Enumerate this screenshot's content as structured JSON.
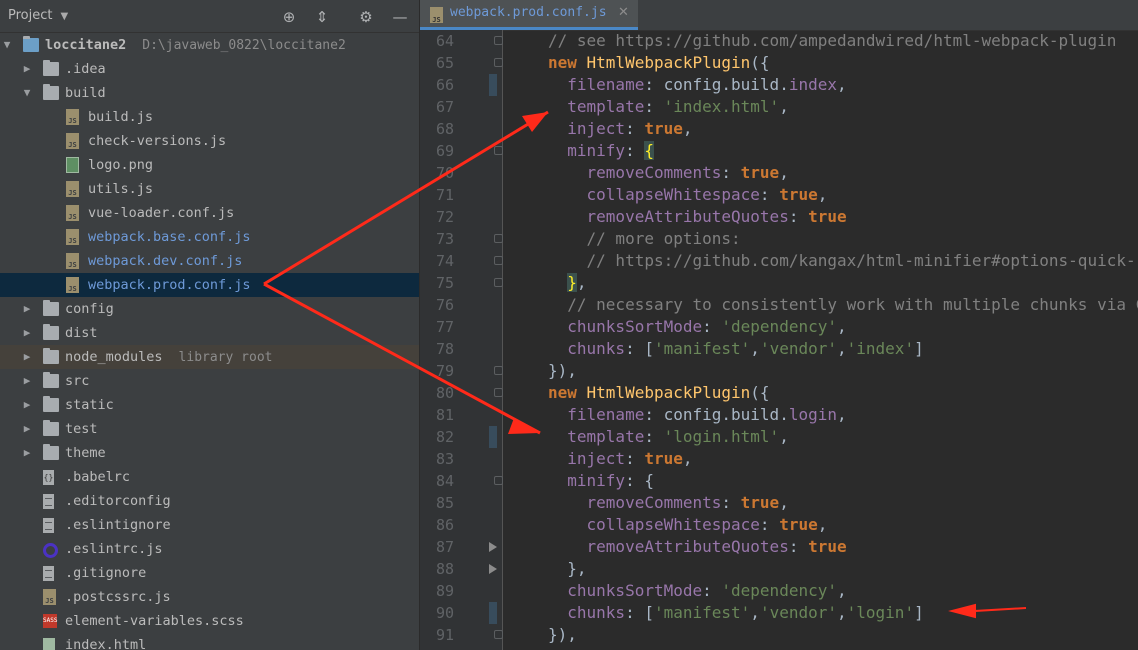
{
  "project_panel": {
    "title": "Project",
    "tree": [
      {
        "label": "loccitane2",
        "hint": "D:\\javaweb_0822\\loccitane2",
        "kind": "project",
        "depth": 0,
        "arrow": "down"
      },
      {
        "label": ".idea",
        "kind": "folder",
        "depth": 1,
        "arrow": "right"
      },
      {
        "label": "build",
        "kind": "folder",
        "depth": 1,
        "arrow": "down"
      },
      {
        "label": "build.js",
        "kind": "js",
        "depth": 2
      },
      {
        "label": "check-versions.js",
        "kind": "js",
        "depth": 2
      },
      {
        "label": "logo.png",
        "kind": "png",
        "depth": 2
      },
      {
        "label": "utils.js",
        "kind": "js",
        "depth": 2
      },
      {
        "label": "vue-loader.conf.js",
        "kind": "js",
        "depth": 2
      },
      {
        "label": "webpack.base.conf.js",
        "kind": "js",
        "depth": 2,
        "modified": true
      },
      {
        "label": "webpack.dev.conf.js",
        "kind": "js",
        "depth": 2,
        "modified": true
      },
      {
        "label": "webpack.prod.conf.js",
        "kind": "js",
        "depth": 2,
        "modified": true,
        "selected": true
      },
      {
        "label": "config",
        "kind": "folder",
        "depth": 1,
        "arrow": "right"
      },
      {
        "label": "dist",
        "kind": "folder",
        "depth": 1,
        "arrow": "right"
      },
      {
        "label": "node_modules",
        "hint": "library root",
        "kind": "folder",
        "depth": 1,
        "arrow": "right",
        "libroot": true
      },
      {
        "label": "src",
        "kind": "folder",
        "depth": 1,
        "arrow": "right"
      },
      {
        "label": "static",
        "kind": "folder",
        "depth": 1,
        "arrow": "right"
      },
      {
        "label": "test",
        "kind": "folder",
        "depth": 1,
        "arrow": "right"
      },
      {
        "label": "theme",
        "kind": "folder",
        "depth": 1,
        "arrow": "right"
      },
      {
        "label": ".babelrc",
        "kind": "babel",
        "depth": 1
      },
      {
        "label": ".editorconfig",
        "kind": "txt",
        "depth": 1
      },
      {
        "label": ".eslintignore",
        "kind": "txt",
        "depth": 1
      },
      {
        "label": ".eslintrc.js",
        "kind": "eslint",
        "depth": 1
      },
      {
        "label": ".gitignore",
        "kind": "txt",
        "depth": 1
      },
      {
        "label": ".postcssrc.js",
        "kind": "js",
        "depth": 1
      },
      {
        "label": "element-variables.scss",
        "kind": "sass",
        "depth": 1
      },
      {
        "label": "index.html",
        "kind": "html",
        "depth": 1
      }
    ]
  },
  "editor": {
    "tab_label": "webpack.prod.conf.js",
    "lines": [
      {
        "n": "64",
        "gutter": "fold",
        "tokens": [
          [
            "cm",
            "// see https://github.com/ampedandwired/html-webpack-plugin"
          ]
        ]
      },
      {
        "n": "65",
        "gutter": "fold",
        "tokens": [
          [
            "kw",
            "new "
          ],
          [
            "fn",
            "HtmlWebpackPlugin"
          ],
          [
            "pl",
            "({"
          ]
        ]
      },
      {
        "n": "66",
        "gutter": "chg",
        "tokens": [
          [
            "pl",
            "  "
          ],
          [
            "pr",
            "filename"
          ],
          [
            "pl",
            ": config.build."
          ],
          [
            "pr",
            "index"
          ],
          [
            "pl",
            ","
          ]
        ]
      },
      {
        "n": "67",
        "gutter": "",
        "tokens": [
          [
            "pl",
            "  "
          ],
          [
            "pr",
            "template"
          ],
          [
            "pl",
            ": "
          ],
          [
            "st",
            "'index.html'"
          ],
          [
            "pl",
            ","
          ]
        ]
      },
      {
        "n": "68",
        "gutter": "",
        "tokens": [
          [
            "pl",
            "  "
          ],
          [
            "pr",
            "inject"
          ],
          [
            "pl",
            ": "
          ],
          [
            "kw",
            "true"
          ],
          [
            "pl",
            ","
          ]
        ]
      },
      {
        "n": "69",
        "gutter": "fold",
        "tokens": [
          [
            "pl",
            "  "
          ],
          [
            "pr",
            "minify"
          ],
          [
            "pl",
            ": "
          ],
          [
            "brk",
            "{"
          ]
        ]
      },
      {
        "n": "70",
        "gutter": "",
        "tokens": [
          [
            "pl",
            "    "
          ],
          [
            "pr",
            "removeComments"
          ],
          [
            "pl",
            ": "
          ],
          [
            "kw",
            "true"
          ],
          [
            "pl",
            ","
          ]
        ]
      },
      {
        "n": "71",
        "gutter": "",
        "tokens": [
          [
            "pl",
            "    "
          ],
          [
            "pr",
            "collapseWhitespace"
          ],
          [
            "pl",
            ": "
          ],
          [
            "kw",
            "true"
          ],
          [
            "pl",
            ","
          ]
        ]
      },
      {
        "n": "72",
        "gutter": "",
        "tokens": [
          [
            "pl",
            "    "
          ],
          [
            "pr",
            "removeAttributeQuotes"
          ],
          [
            "pl",
            ": "
          ],
          [
            "kw",
            "true"
          ]
        ]
      },
      {
        "n": "73",
        "gutter": "fold",
        "tokens": [
          [
            "cm",
            "    // more options:"
          ]
        ]
      },
      {
        "n": "74",
        "gutter": "fold",
        "tokens": [
          [
            "cm",
            "    // https://github.com/kangax/html-minifier#options-quick-reference"
          ]
        ]
      },
      {
        "n": "75",
        "gutter": "fold",
        "tokens": [
          [
            "pl",
            "  "
          ],
          [
            "brk",
            "}"
          ],
          [
            "pl",
            ","
          ]
        ]
      },
      {
        "n": "76",
        "gutter": "",
        "tokens": [
          [
            "cm",
            "  // necessary to consistently work with multiple chunks via CommonsChunkPlugin"
          ]
        ]
      },
      {
        "n": "77",
        "gutter": "",
        "tokens": [
          [
            "pl",
            "  "
          ],
          [
            "pr",
            "chunksSortMode"
          ],
          [
            "pl",
            ": "
          ],
          [
            "st",
            "'dependency'"
          ],
          [
            "pl",
            ","
          ]
        ]
      },
      {
        "n": "78",
        "gutter": "",
        "tokens": [
          [
            "pl",
            "  "
          ],
          [
            "pr",
            "chunks"
          ],
          [
            "pl",
            ": ["
          ],
          [
            "st",
            "'manifest'"
          ],
          [
            "pl",
            ","
          ],
          [
            "st",
            "'vendor'"
          ],
          [
            "pl",
            ","
          ],
          [
            "st",
            "'index'"
          ],
          [
            "pl",
            "]"
          ]
        ]
      },
      {
        "n": "79",
        "gutter": "fold",
        "tokens": [
          [
            "pl",
            "}),"
          ]
        ]
      },
      {
        "n": "80",
        "gutter": "fold",
        "tokens": [
          [
            "kw",
            "new "
          ],
          [
            "fn",
            "HtmlWebpackPlugin"
          ],
          [
            "pl",
            "({"
          ]
        ]
      },
      {
        "n": "81",
        "gutter": "",
        "tokens": [
          [
            "pl",
            "  "
          ],
          [
            "pr",
            "filename"
          ],
          [
            "pl",
            ": config.build."
          ],
          [
            "pr",
            "login"
          ],
          [
            "pl",
            ","
          ]
        ]
      },
      {
        "n": "82",
        "gutter": "chg",
        "tokens": [
          [
            "pl",
            "  "
          ],
          [
            "pr",
            "template"
          ],
          [
            "pl",
            ": "
          ],
          [
            "st",
            "'login.html'"
          ],
          [
            "pl",
            ","
          ]
        ]
      },
      {
        "n": "83",
        "gutter": "",
        "tokens": [
          [
            "pl",
            "  "
          ],
          [
            "pr",
            "inject"
          ],
          [
            "pl",
            ": "
          ],
          [
            "kw",
            "true"
          ],
          [
            "pl",
            ","
          ]
        ]
      },
      {
        "n": "84",
        "gutter": "fold",
        "tokens": [
          [
            "pl",
            "  "
          ],
          [
            "pr",
            "minify"
          ],
          [
            "pl",
            ": {"
          ]
        ]
      },
      {
        "n": "85",
        "gutter": "",
        "tokens": [
          [
            "pl",
            "    "
          ],
          [
            "pr",
            "removeComments"
          ],
          [
            "pl",
            ": "
          ],
          [
            "kw",
            "true"
          ],
          [
            "pl",
            ","
          ]
        ]
      },
      {
        "n": "86",
        "gutter": "",
        "tokens": [
          [
            "pl",
            "    "
          ],
          [
            "pr",
            "collapseWhitespace"
          ],
          [
            "pl",
            ": "
          ],
          [
            "kw",
            "true"
          ],
          [
            "pl",
            ","
          ]
        ]
      },
      {
        "n": "87",
        "gutter": "tri",
        "tokens": [
          [
            "pl",
            "    "
          ],
          [
            "pr",
            "removeAttributeQuotes"
          ],
          [
            "pl",
            ": "
          ],
          [
            "kw",
            "true"
          ]
        ]
      },
      {
        "n": "88",
        "gutter": "tri",
        "tokens": [
          [
            "pl",
            "  },"
          ]
        ]
      },
      {
        "n": "89",
        "gutter": "",
        "tokens": [
          [
            "pl",
            "  "
          ],
          [
            "pr",
            "chunksSortMode"
          ],
          [
            "pl",
            ": "
          ],
          [
            "st",
            "'dependency'"
          ],
          [
            "pl",
            ","
          ]
        ]
      },
      {
        "n": "90",
        "gutter": "chg",
        "tokens": [
          [
            "pl",
            "  "
          ],
          [
            "pr",
            "chunks"
          ],
          [
            "pl",
            ": ["
          ],
          [
            "st",
            "'manifest'"
          ],
          [
            "pl",
            ","
          ],
          [
            "st",
            "'vendor'"
          ],
          [
            "pl",
            ","
          ],
          [
            "st",
            "'login'"
          ],
          [
            "pl",
            "]"
          ]
        ]
      },
      {
        "n": "91",
        "gutter": "fold",
        "tokens": [
          [
            "pl",
            "}),"
          ]
        ]
      }
    ]
  },
  "colors": {
    "annotation_arrow": "#ff2a1a"
  }
}
